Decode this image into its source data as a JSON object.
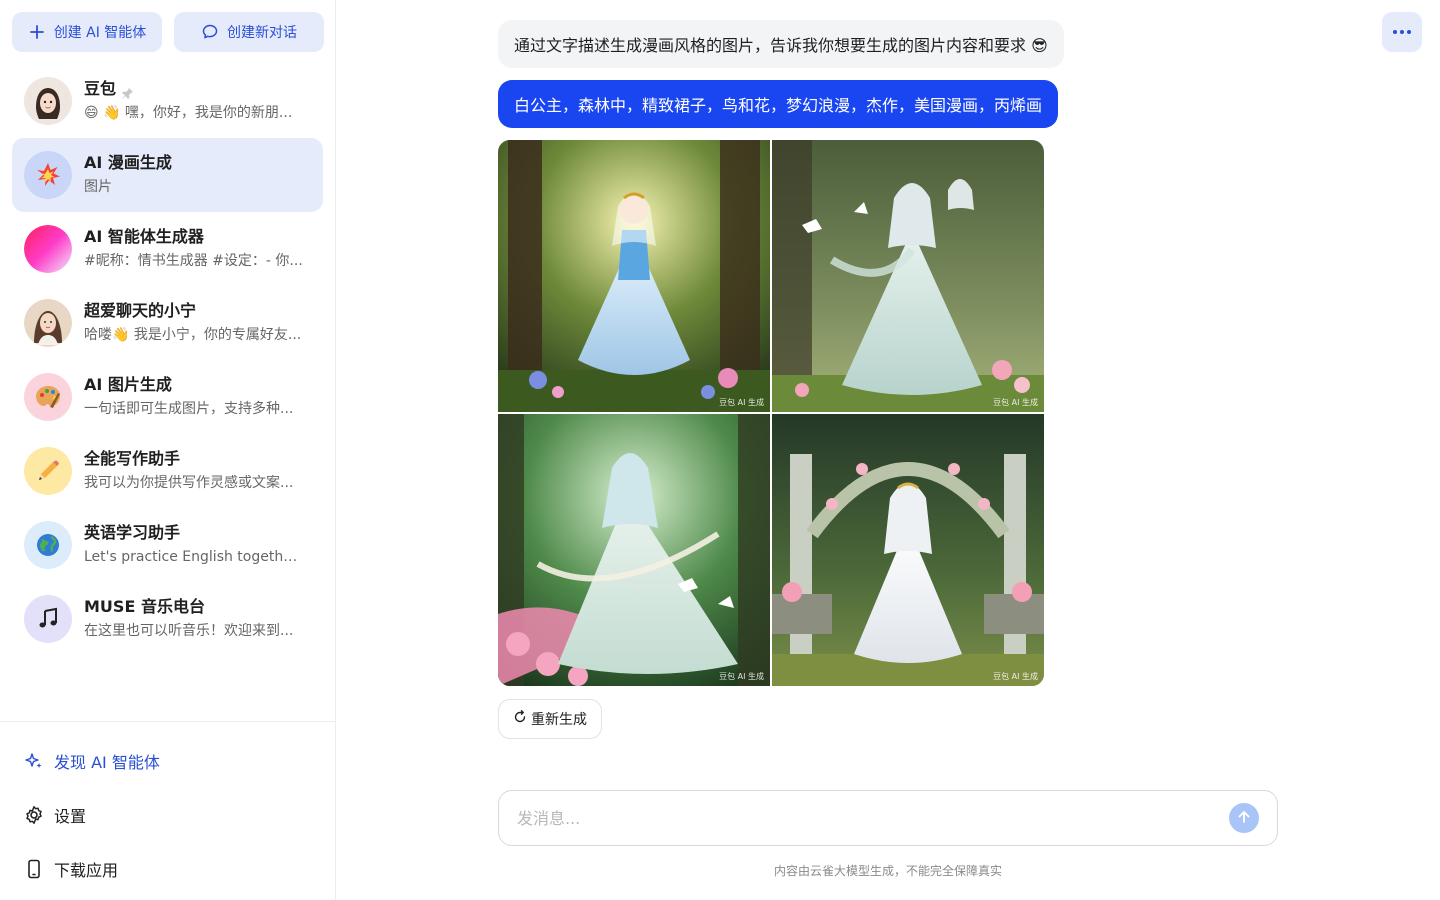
{
  "sidebar": {
    "create_agent_label": "创建 AI 智能体",
    "new_chat_label": "创建新对话",
    "bots": [
      {
        "name": "豆包",
        "desc": "😄 👋 嘿，你好，我是你的新朋...",
        "pinned": true,
        "avatar_icon": "girl-face-icon",
        "avatar_bg": "#f3ece6"
      },
      {
        "name": "AI 漫画生成",
        "desc": "图片",
        "active": true,
        "avatar_icon": "collision-icon",
        "avatar_bg": "#c9d6f7"
      },
      {
        "name": "AI 智能体生成器",
        "desc": "#昵称：情书生成器 #设定：- 你...",
        "avatar_icon": "gradient-sphere-icon",
        "avatar_bg": "#ff2a6e"
      },
      {
        "name": "超爱聊天的小宁",
        "desc": "哈喽👋 我是小宁，你的专属好友...",
        "avatar_icon": "girl-portrait-icon",
        "avatar_bg": "#d9c2a8"
      },
      {
        "name": "AI 图片生成",
        "desc": "一句话即可生成图片，支持多种...",
        "avatar_icon": "palette-icon",
        "avatar_bg": "#fbd3dc"
      },
      {
        "name": "全能写作助手",
        "desc": "我可以为你提供写作灵感或文案...",
        "avatar_icon": "pencil-icon",
        "avatar_bg": "#fde9a4"
      },
      {
        "name": "英语学习助手",
        "desc": "Let's practice English together. ...",
        "avatar_icon": "globe-icon",
        "avatar_bg": "#dcecfb"
      },
      {
        "name": "MUSE 音乐电台",
        "desc": "在这里也可以听音乐！欢迎来到...",
        "avatar_icon": "music-note-icon",
        "avatar_bg": "#e3e0fa"
      }
    ],
    "footer": {
      "discover_label": "发现 AI 智能体",
      "settings_label": "设置",
      "download_label": "下载应用"
    }
  },
  "chat": {
    "bot_message": "通过文字描述生成漫画风格的图片，告诉我你想要生成的图片内容和要求 😎",
    "user_message": "白公主，森林中，精致裙子，鸟和花，梦幻浪漫，杰作，美国漫画，丙烯画",
    "images": [
      {
        "alt": "princess-forest-1",
        "watermark": "豆包 AI 生成"
      },
      {
        "alt": "princess-forest-2",
        "watermark": "豆包 AI 生成",
        "corner_text": "豆包"
      },
      {
        "alt": "princess-forest-3",
        "watermark": "豆包 AI 生成"
      },
      {
        "alt": "princess-forest-4",
        "watermark": "豆包 AI 生成"
      }
    ],
    "regenerate_label": "重新生成"
  },
  "composer": {
    "placeholder": "发消息...",
    "disclaimer": "内容由云雀大模型生成，不能完全保障真实"
  },
  "colors": {
    "accent": "#1a46f2",
    "accent_soft": "#e6ebfc",
    "link": "#2a4fd6"
  }
}
